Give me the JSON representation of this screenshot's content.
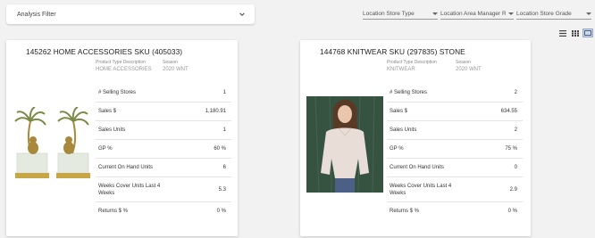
{
  "filter": {
    "label": "Analysis Filter"
  },
  "dropdowns": [
    {
      "label": "Location Store Type"
    },
    {
      "label": "Location Area Manager Re..."
    },
    {
      "label": "Location Store Grade"
    }
  ],
  "colors": {
    "background": "#f2f2f2",
    "card": "#ffffff",
    "accent": "#8fa4c4"
  },
  "view_toggle_icons": [
    "list-view-icon",
    "grid-view-icon",
    "card-view-icon"
  ],
  "cards": [
    {
      "title": "145262 HOME ACCESSORIES SKU (405033)",
      "product_type_label": "Product Type Description",
      "product_type_value": "HOME ACCESSORIES",
      "season_label": "Season",
      "season_value": "2020 WNT",
      "metrics": [
        {
          "label": "# Selling Stores",
          "value": "1"
        },
        {
          "label": "Sales $",
          "value": "1,180.91"
        },
        {
          "label": "Sales Units",
          "value": "1"
        },
        {
          "label": "GP %",
          "value": "60 %"
        },
        {
          "label": "Current On Hand Units",
          "value": "6"
        },
        {
          "label": "Weeks Cover Units Last 4 Weeks",
          "value": "5.3"
        },
        {
          "label": "Returns $ %",
          "value": "0 %"
        }
      ]
    },
    {
      "title": "144768 KNITWEAR SKU (297835) STONE",
      "product_type_label": "Product Type Description",
      "product_type_value": "KNITWEAR",
      "season_label": "Season",
      "season_value": "2020 WNT",
      "metrics": [
        {
          "label": "# Selling Stores",
          "value": "2"
        },
        {
          "label": "Sales $",
          "value": "634.55"
        },
        {
          "label": "Sales Units",
          "value": "2"
        },
        {
          "label": "GP %",
          "value": "75 %"
        },
        {
          "label": "Current On Hand Units",
          "value": "0"
        },
        {
          "label": "Weeks Cover Units Last 4 Weeks",
          "value": "2.9"
        },
        {
          "label": "Returns $ %",
          "value": "0 %"
        }
      ]
    }
  ]
}
